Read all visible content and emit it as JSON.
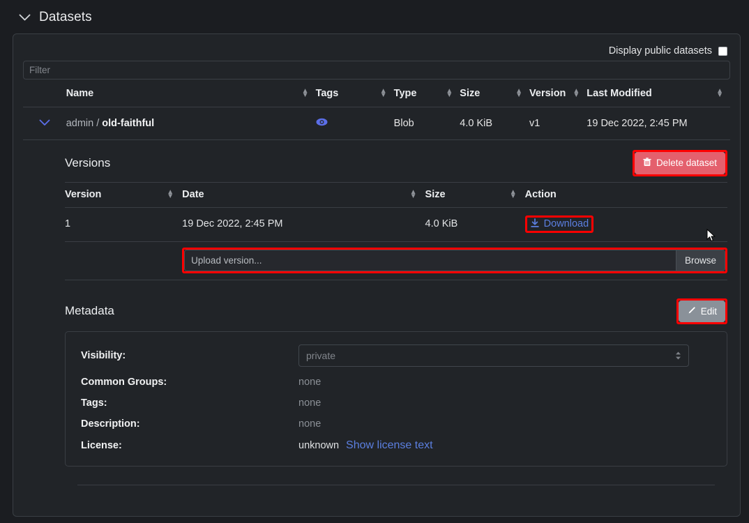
{
  "section": {
    "title": "Datasets",
    "collapse_icon": "chevron-down-icon"
  },
  "toolbar": {
    "public_label": "Display public datasets",
    "public_checked": false
  },
  "filter": {
    "placeholder": "Filter",
    "value": ""
  },
  "datasets_table": {
    "columns": [
      "Name",
      "Tags",
      "Type",
      "Size",
      "Version",
      "Last Modified"
    ],
    "rows": [
      {
        "expanded": true,
        "owner": "admin /",
        "name": "old-faithful",
        "tags_icon": "eye-icon",
        "type": "Blob",
        "size": "4.0 KiB",
        "version": "v1",
        "last_modified": "19 Dec 2022, 2:45 PM"
      }
    ]
  },
  "versions": {
    "title": "Versions",
    "delete_button": {
      "label": "Delete dataset",
      "icon": "trash-icon",
      "color": "#e4606d",
      "highlighted": true
    },
    "columns": [
      "Version",
      "Date",
      "Size",
      "Action"
    ],
    "rows": [
      {
        "version": "1",
        "date": "19 Dec 2022, 2:45 PM",
        "size": "4.0 KiB",
        "action_label": "Download",
        "action_icon": "download-icon"
      }
    ],
    "upload": {
      "placeholder": "Upload version...",
      "browse_label": "Browse",
      "highlighted": true
    }
  },
  "metadata": {
    "title": "Metadata",
    "edit_button": {
      "label": "Edit",
      "icon": "pencil-icon",
      "highlighted": true
    },
    "fields": [
      {
        "label": "Visibility:",
        "value": "private",
        "type": "select"
      },
      {
        "label": "Common Groups:",
        "value": "none",
        "type": "text"
      },
      {
        "label": "Tags:",
        "value": "none",
        "type": "text"
      },
      {
        "label": "Description:",
        "value": "none",
        "type": "text"
      },
      {
        "label": "License:",
        "value": "unknown",
        "type": "license",
        "link_label": "Show license text"
      }
    ]
  },
  "colors": {
    "accent_blue": "#5b6ee8",
    "link_blue": "#5b7fe0",
    "danger_red": "#e4606d",
    "annotation_red": "#ff0000",
    "background": "#1b1d21",
    "card_background": "#212428",
    "border": "#3a3e44"
  }
}
